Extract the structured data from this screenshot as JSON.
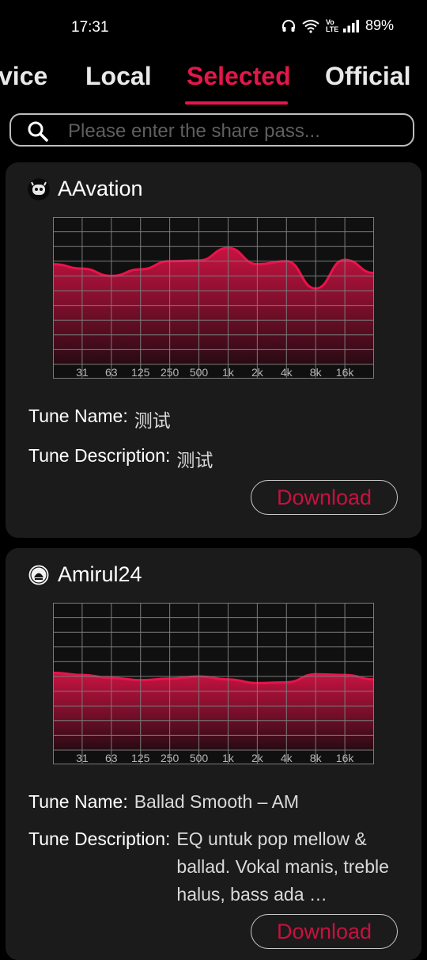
{
  "status_bar": {
    "time": "17:31",
    "network": "Vo LTE",
    "battery": "89%"
  },
  "tabs": [
    {
      "label": "vice",
      "active": false
    },
    {
      "label": "Local",
      "active": false
    },
    {
      "label": "Selected",
      "active": true
    },
    {
      "label": "Official",
      "active": false
    }
  ],
  "search": {
    "placeholder": "Please enter the share pass...",
    "value": ""
  },
  "colors": {
    "accent": "#e3174a",
    "card_bg": "#1b1b1b",
    "curve": "#e8134a"
  },
  "eq_bands": [
    "31",
    "63",
    "125",
    "250",
    "500",
    "1k",
    "2k",
    "4k",
    "8k",
    "16k"
  ],
  "presets": [
    {
      "author": "AAvation",
      "avatar_icon": "robot-face-icon",
      "tune_name_label": "Tune Name:",
      "tune_name": "测试",
      "tune_description_label": "Tune Description:",
      "tune_description": "测试",
      "download_label": "Download",
      "curve": [
        0.36,
        0.3,
        0.2,
        0.29,
        0.4,
        0.41,
        0.58,
        0.36,
        0.4,
        0.03,
        0.42,
        0.24
      ]
    },
    {
      "author": "Amirul24",
      "avatar_icon": "emblem-icon",
      "tune_name_label": "Tune Name:",
      "tune_name": "Ballad Smooth – AM",
      "tune_description_label": "Tune Description:",
      "tune_description": "EQ untuk pop mellow & ballad. Vokal manis, treble halus, bass ada …",
      "download_label": "Download",
      "curve": [
        0.05,
        0.02,
        -0.02,
        -0.05,
        -0.03,
        0.0,
        -0.04,
        -0.09,
        -0.08,
        0.03,
        0.02,
        -0.04
      ]
    }
  ]
}
